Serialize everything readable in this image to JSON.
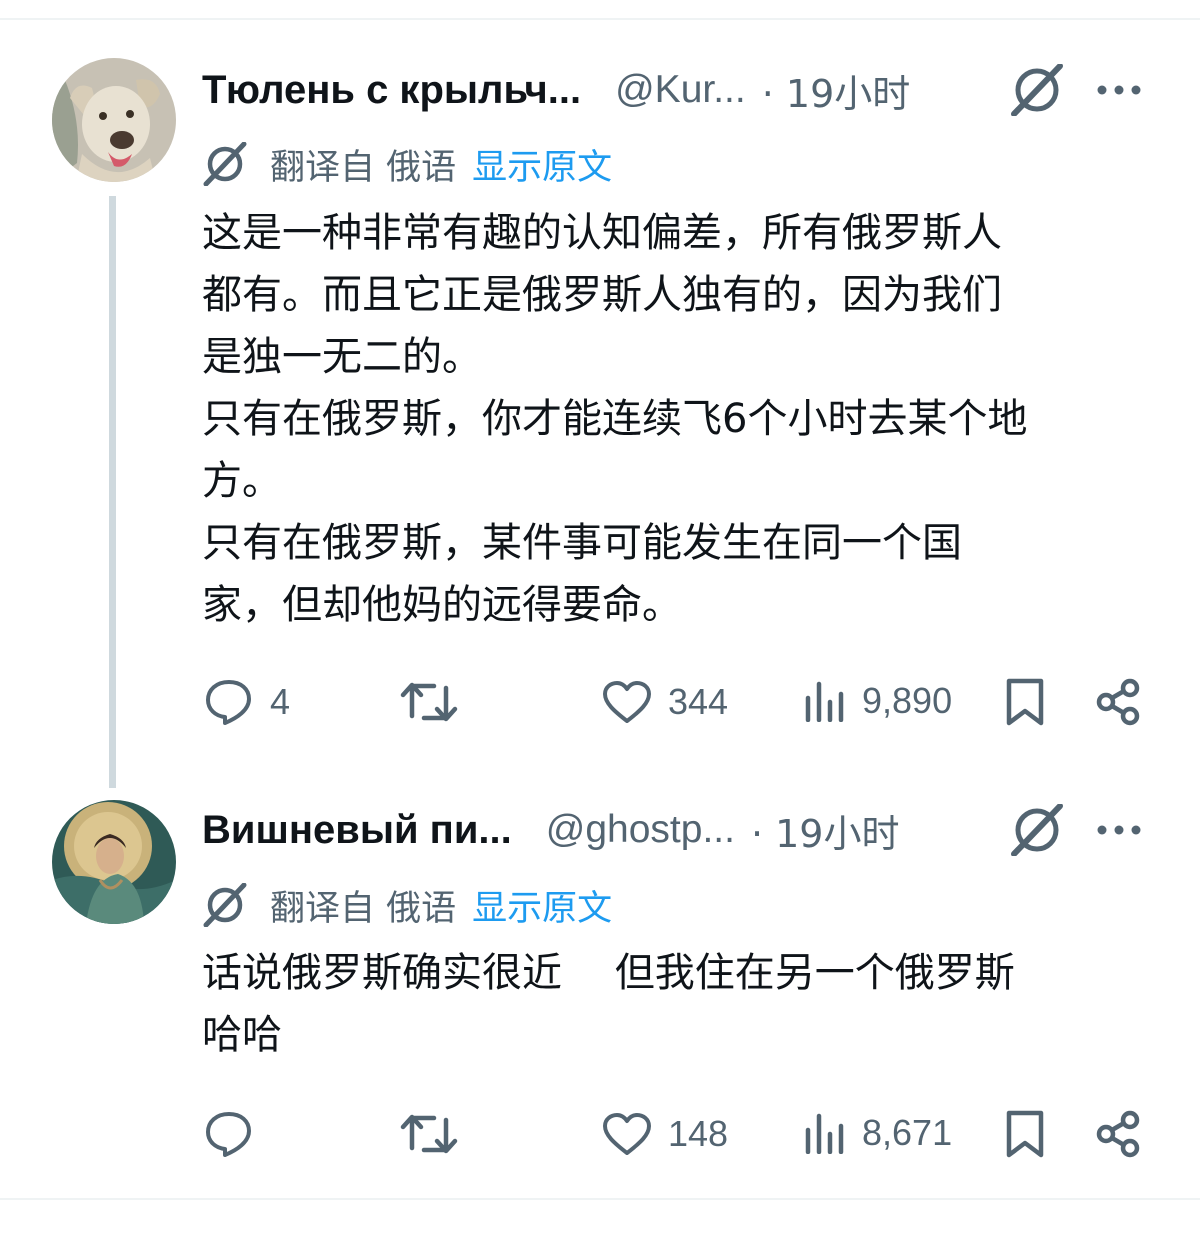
{
  "colors": {
    "accent": "#1d9bf0",
    "muted": "#536471",
    "text": "#0f1419",
    "thread_line": "#cfd9de"
  },
  "tweets": [
    {
      "avatar_icon": "dog-avatar",
      "name": "Тюлень с крыльч...",
      "handle": "@Kur...",
      "time": "· 19小时",
      "translated_from": "翻译自 俄语",
      "show_original": "显示原文",
      "lines": [
        "这是一种非常有趣的认知偏差，所有俄罗斯人",
        "都有。而且它正是俄罗斯人独有的，因为我们",
        "是独一无二的。",
        "只有在俄罗斯，你才能连续飞6个小时去某个地",
        "方。",
        "只有在俄罗斯，某件事可能发生在同一个国",
        "家，但却他妈的远得要命。"
      ],
      "stats": {
        "replies": "4",
        "reposts": "",
        "likes": "344",
        "views": "9,890"
      }
    },
    {
      "avatar_icon": "painted-woman-avatar",
      "name": "Вишневый пи...",
      "handle": "@ghostp...",
      "time": "· 19小时",
      "translated_from": "翻译自 俄语",
      "show_original": "显示原文",
      "lines": [
        "话说俄罗斯确实很近　 但我住在另一个俄罗斯",
        "哈哈"
      ],
      "stats": {
        "replies": "",
        "reposts": "",
        "likes": "148",
        "views": "8,671"
      }
    }
  ]
}
